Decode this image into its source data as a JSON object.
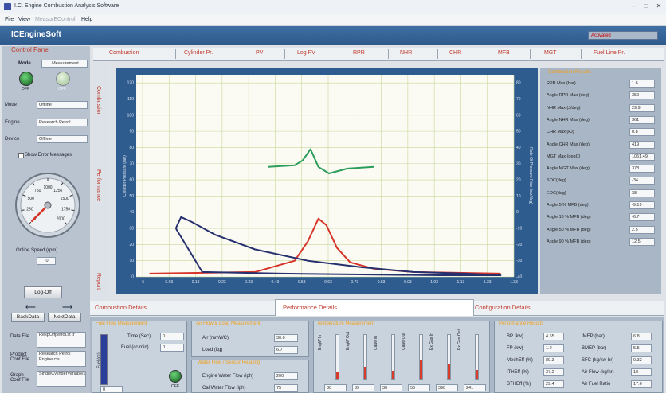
{
  "window": {
    "title": "I.C. Engine Combustion Analysis Software"
  },
  "menu": [
    "File",
    "View",
    "MeasurEControl",
    "Help"
  ],
  "brand": "ICEngineSoft",
  "status": "Activated",
  "control_panel": {
    "title": "Control Panel",
    "mode_label": "Mode",
    "measurement_label": "Measurement",
    "off_label": "OFF",
    "off_label2": "OFF",
    "mode_field_label": "Mode",
    "mode_value": "Offline",
    "engine_label": "Engine",
    "engine_value": "Research Petrol",
    "device_label": "Device",
    "device_value": "Offline",
    "show_errors": "Show Error Messages",
    "gauge_ticks": [
      "0",
      "250",
      "500",
      "750",
      "1000",
      "1250",
      "1500",
      "1750",
      "2000"
    ],
    "gauge_value": 0,
    "speed_label": "Online Speed (rpm)",
    "speed_value": "0",
    "logoff": "Log-Off",
    "back": "BackData",
    "next": "NextData",
    "data_file_label": "Data File",
    "data_file_value": "RespOffpetrol.st tr",
    "product_label": "Product Conf File",
    "product_value": "Research Petrol Engine.cfs",
    "graph_label": "Graph Conf File",
    "graph_value": "SingleCylinderVariableSpeed.cvs"
  },
  "tabs": [
    "Combustion",
    "Cylinder Pr.",
    "PV",
    "Log PV",
    "RPR",
    "NHR",
    "CHR",
    "MFB",
    "MGT",
    "Fuel Line Pr."
  ],
  "side_tabs": [
    "Combustion",
    "Performance",
    "Report"
  ],
  "chart": {
    "y_left_ticks": [
      "0",
      "10",
      "20",
      "30",
      "40",
      "50",
      "60",
      "70",
      "80",
      "90",
      "100",
      "110",
      "120"
    ],
    "y_right_ticks": [
      "-40",
      "-30",
      "-20",
      "-10",
      "0",
      "10",
      "20",
      "30",
      "40",
      "50",
      "60",
      "70",
      "80"
    ],
    "x_ticks": [
      "-5",
      "0.03",
      "0.13",
      "0.23",
      "0.33",
      "0.43",
      "0.53",
      "0.63",
      "0.73",
      "0.83",
      "0.93",
      "1.03",
      "1.13",
      "1.23",
      "1.33"
    ],
    "y_left_label": "Cylinder Pressure (bar)",
    "y_right_label": "Rate Of Pressure Rise (bar/deg)"
  },
  "chart_data": {
    "type": "line",
    "series": [
      {
        "color": "#d8352a",
        "x": [
          0.0,
          0.4,
          0.55,
          0.6,
          0.64,
          0.67,
          0.71,
          0.76,
          0.85,
          1.0,
          1.33
        ],
        "y": [
          2,
          3,
          10,
          22,
          36,
          32,
          18,
          9,
          5,
          3,
          2
        ]
      },
      {
        "color": "#2a9d5a",
        "x": [
          0.45,
          0.55,
          0.58,
          0.61,
          0.64,
          0.68,
          0.75,
          0.85
        ],
        "y": [
          68,
          69,
          72,
          79,
          68,
          64,
          67,
          68
        ]
      },
      {
        "color": "#27306e",
        "x": [
          0.1,
          0.12,
          0.16,
          0.25,
          0.4,
          0.6,
          0.8,
          1.0,
          1.2,
          1.33,
          1.1,
          0.8,
          0.5,
          0.2,
          0.1
        ],
        "y": [
          30,
          37,
          34,
          26,
          17,
          10,
          6,
          3,
          2,
          1,
          1,
          1.5,
          2,
          3,
          30
        ]
      }
    ],
    "xlim": [
      -0.05,
      1.38
    ],
    "ylim": [
      0,
      125
    ]
  },
  "results": {
    "title": "Combustion Results",
    "rows": [
      {
        "label": "RPR Max (bar)",
        "value": "1.6"
      },
      {
        "label": "Angle RPR Max (deg)",
        "value": "359"
      },
      {
        "label": "NHR Max (J/deg)",
        "value": "29.9"
      },
      {
        "label": "Angle NHR Max (deg)",
        "value": "361"
      },
      {
        "label": "CHR Max (kJ)",
        "value": "0.8"
      },
      {
        "label": "Angle CHR Max (deg)",
        "value": "419"
      },
      {
        "label": "MGT Max (degC)",
        "value": "1061.49"
      },
      {
        "label": "Angle MGT Max (deg)",
        "value": "378"
      },
      {
        "label": "SOC(deg)",
        "value": "-34"
      },
      {
        "label": "EOC(deg)",
        "value": "38"
      },
      {
        "label": "Angle 5 % MFB (deg)",
        "value": "-9.19"
      },
      {
        "label": "Angle 10 % MFB (deg)",
        "value": "-6.7"
      },
      {
        "label": "Angle 50 % MFB (deg)",
        "value": "2.5"
      },
      {
        "label": "Angle 90 % MFB (deg)",
        "value": "12.5"
      }
    ]
  },
  "bottom_tabs": [
    "Combustion Details",
    "Performance Details",
    "Configuration Details"
  ],
  "perf": {
    "fuel_title": "Fuel Flow Measurement",
    "time_label": "Time (Sec)",
    "time_value": "0",
    "fuel_label": "Fuel (cc/min)",
    "fuel_value": "0",
    "fuel_axis": "Fuel (cc)",
    "fuel_box": "0",
    "off_label": "OFF",
    "air_title": "Air Flow & Load Measurement",
    "air_label": "Air (mmWC)",
    "air_value": "30.0",
    "load_label": "Load (kg)",
    "load_value": "6.7",
    "water_title": "Water Flow / Sensor Reading",
    "ewf_label": "Engine Water Flow (lph)",
    "ewf_value": "200",
    "cwf_label": "Cal Water Flow (lph)",
    "cwf_value": "75",
    "temp_title": "Temperature Measurement",
    "temps": [
      {
        "label": "EngW In",
        "value": "30",
        "fill": 0.18
      },
      {
        "label": "EngW Out",
        "value": "39",
        "fill": 0.28
      },
      {
        "label": "CalW In",
        "value": "30",
        "fill": 0.2
      },
      {
        "label": "CalW Out",
        "value": "56",
        "fill": 0.45
      },
      {
        "label": "Ex Gas In",
        "value": "398",
        "fill": 0.35
      },
      {
        "label": "Ex Gas Out",
        "value": "241",
        "fill": 0.22
      }
    ],
    "temp_scale": [
      "0",
      "200",
      "400",
      "600",
      "800",
      "1000",
      "1200"
    ],
    "perf_title": "Performance Results",
    "perf_rows_left": [
      {
        "label": "BP (kw)",
        "value": "4.65"
      },
      {
        "label": "FP (kw)",
        "value": "1.2"
      },
      {
        "label": "MechEff (%)",
        "value": "80.3"
      },
      {
        "label": "ITHEff (%)",
        "value": "37.2"
      },
      {
        "label": "BTHEff (%)",
        "value": "29.4"
      }
    ],
    "perf_rows_right": [
      {
        "label": "IMEP (bar)",
        "value": "6.8"
      },
      {
        "label": "BMEP (bar)",
        "value": "5.5"
      },
      {
        "label": "SFC (kg/kw-hr)",
        "value": "0.32"
      },
      {
        "label": "Air Flow (kg/hr)",
        "value": "18"
      },
      {
        "label": "Air Fuel Ratio",
        "value": "17.6"
      }
    ]
  }
}
